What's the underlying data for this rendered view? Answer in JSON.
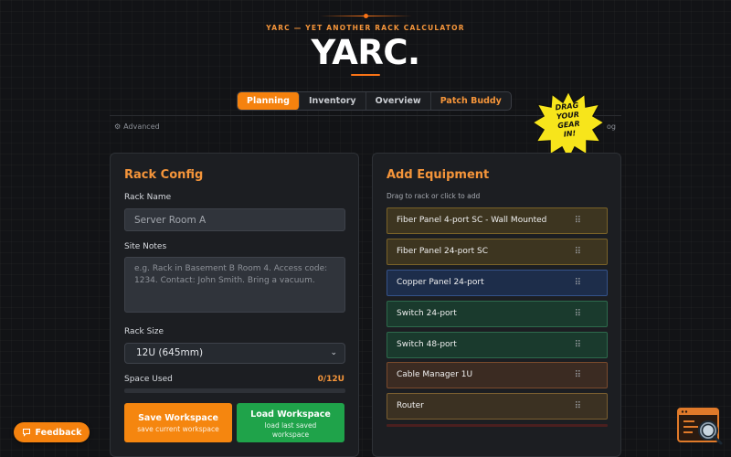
{
  "header": {
    "subtitle": "YARC — YET ANOTHER RACK CALCULATOR",
    "title": "YARC."
  },
  "tabs": [
    {
      "label": "Planning",
      "active": true
    },
    {
      "label": "Inventory",
      "active": false
    },
    {
      "label": "Overview",
      "active": false
    },
    {
      "label": "Patch Buddy",
      "active": false
    }
  ],
  "toolbar": {
    "advanced_label": "Advanced",
    "log_label": "og"
  },
  "burst": {
    "lines": [
      "DRAG",
      "YOUR",
      "GEAR",
      "IN!"
    ]
  },
  "rack_config": {
    "title": "Rack Config",
    "rack_name_label": "Rack Name",
    "rack_name_value": "Server Room A",
    "site_notes_label": "Site Notes",
    "site_notes_placeholder": "e.g. Rack in Basement B Room 4. Access code: 1234. Contact: John Smith. Bring a vacuum.",
    "rack_size_label": "Rack Size",
    "rack_size_value": "12U (645mm)",
    "space_used_label": "Space Used",
    "space_used_value": "0/12U",
    "space_used_fraction": 0,
    "save_label": "Save Workspace",
    "save_sub": "save current workspace",
    "load_label": "Load Workspace",
    "load_sub": "load last saved workspace"
  },
  "add_equipment": {
    "title": "Add Equipment",
    "hint": "Drag to rack or click to add",
    "items": [
      {
        "label": "Fiber Panel 4-port SC - Wall Mounted",
        "kind": "fiber"
      },
      {
        "label": "Fiber Panel 24-port SC",
        "kind": "fiber"
      },
      {
        "label": "Copper Panel 24-port",
        "kind": "copper"
      },
      {
        "label": "Switch 24-port",
        "kind": "switch"
      },
      {
        "label": "Switch 48-port",
        "kind": "switch"
      },
      {
        "label": "Cable Manager 1U",
        "kind": "cable"
      },
      {
        "label": "Router",
        "kind": "router"
      }
    ]
  },
  "feedback_label": "Feedback",
  "colors": {
    "accent": "#f5820e",
    "success": "#1fa34a",
    "background": "#121316",
    "panel": "#1c1e22"
  },
  "icons": {
    "advanced": "gear-icon",
    "feedback": "chat-bubble-icon",
    "grip": "drag-handle-icon",
    "select": "chevron-down-icon",
    "corner": "search-list-icon"
  }
}
